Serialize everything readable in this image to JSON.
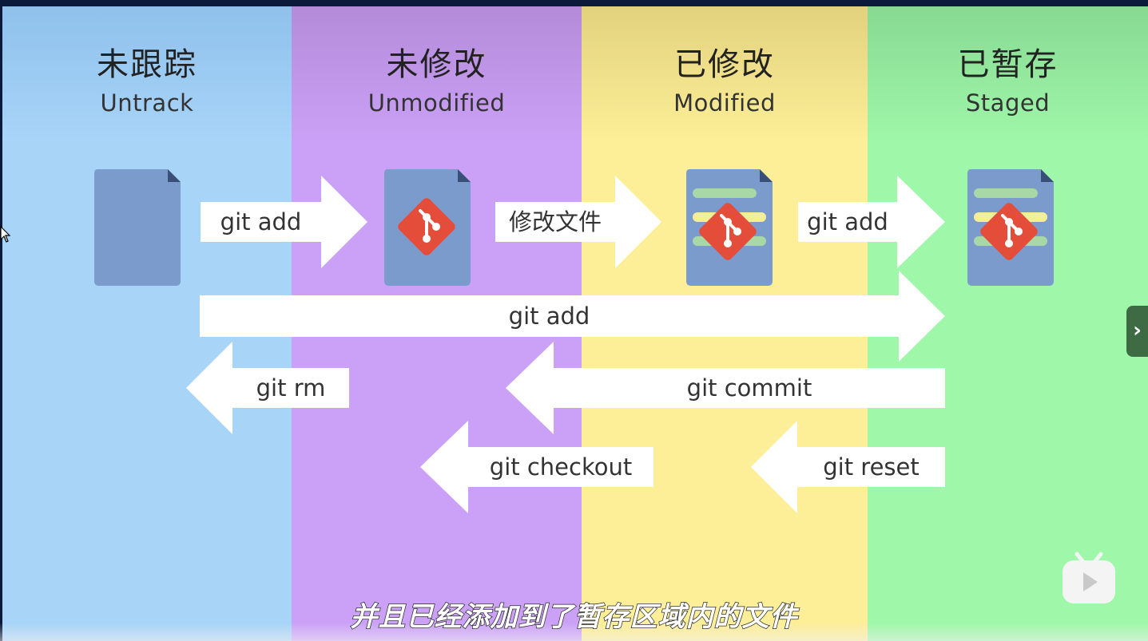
{
  "lanes": [
    {
      "title": "未跟踪",
      "subtitle": "Untrack",
      "color": "#a8d4f8"
    },
    {
      "title": "未修改",
      "subtitle": "Unmodified",
      "color": "#cba1f7"
    },
    {
      "title": "已修改",
      "subtitle": "Modified",
      "color": "#fdee98"
    },
    {
      "title": "已暂存",
      "subtitle": "Staged",
      "color": "#9ff7a9"
    }
  ],
  "arrows": {
    "add_untracked": "git add",
    "modify_file": "修改文件",
    "add_modified": "git add",
    "add_all": "git add",
    "rm": "git rm",
    "commit": "git commit",
    "checkout": "git checkout",
    "reset": "git reset"
  },
  "subtitle": "并且已经添加到了暂存区域内的文件",
  "icons": {
    "doc_color": "#7b9bcd",
    "git_logo_color": "#e44d3a",
    "stripe_green": "#a7d8a6",
    "stripe_yellow": "#f2ef96"
  },
  "ui": {
    "next_icon": "chevron-right-icon",
    "player_icon": "tv-icon",
    "next_glyph": "›"
  }
}
